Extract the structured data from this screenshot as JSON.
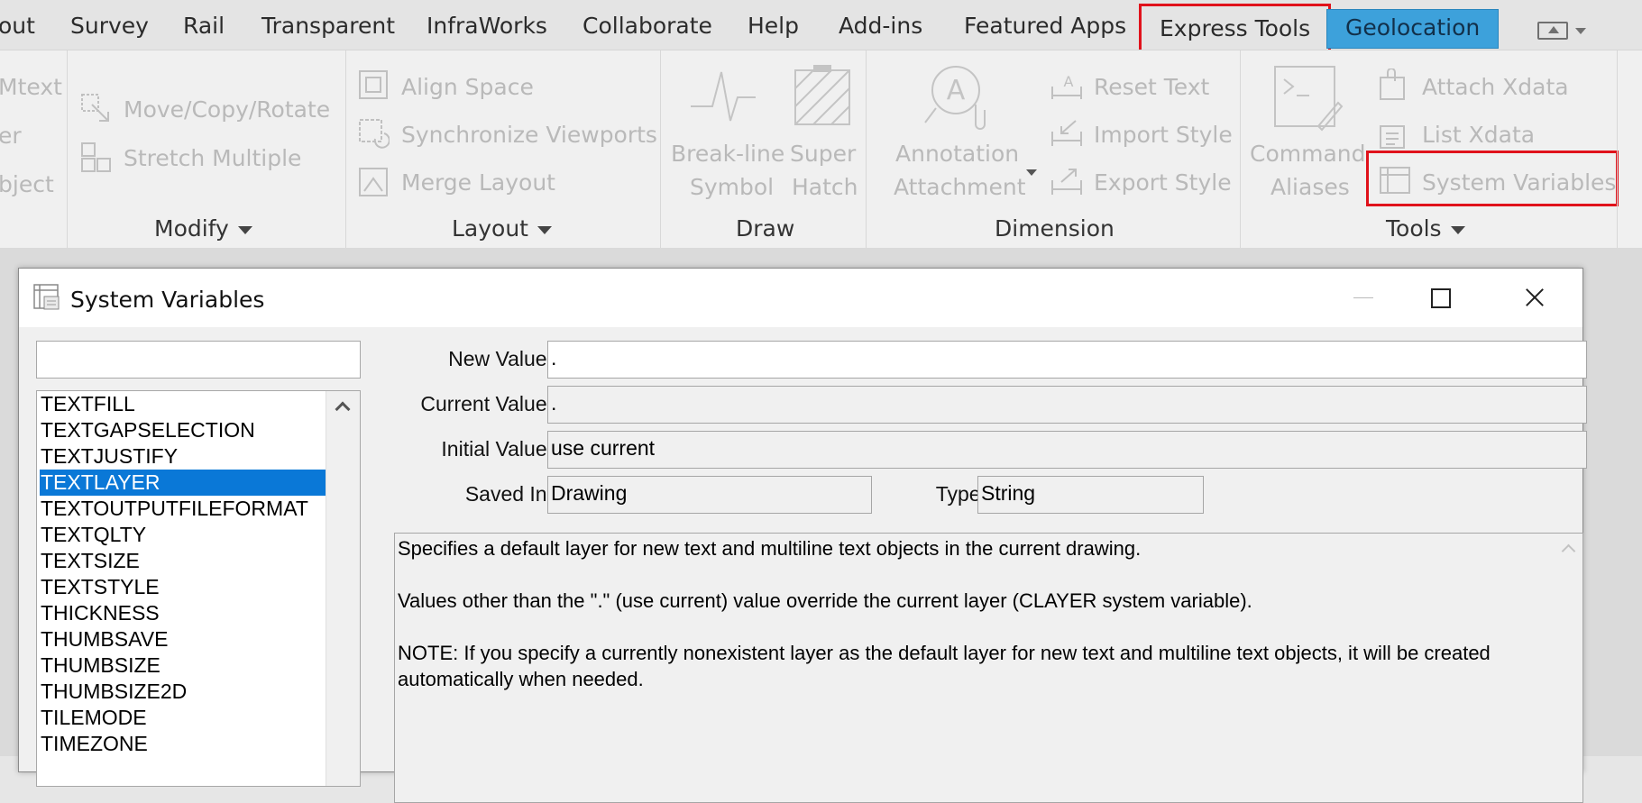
{
  "ribbon_tabs": [
    {
      "label": "out"
    },
    {
      "label": "Survey"
    },
    {
      "label": "Rail"
    },
    {
      "label": "Transparent"
    },
    {
      "label": "InfraWorks"
    },
    {
      "label": "Collaborate"
    },
    {
      "label": "Help"
    },
    {
      "label": "Add-ins"
    },
    {
      "label": "Featured Apps"
    },
    {
      "label": "Express Tools"
    },
    {
      "label": "Geolocation"
    }
  ],
  "ribbon": {
    "cut_labels": [
      "Mtext",
      "er",
      "bject"
    ],
    "modify": {
      "title": "Modify",
      "move_copy_rotate": "Move/Copy/Rotate",
      "stretch_multiple": "Stretch Multiple"
    },
    "layout": {
      "title": "Layout",
      "align_space": "Align Space",
      "synchronize_viewports": "Synchronize Viewports",
      "merge_layout": "Merge Layout"
    },
    "draw": {
      "title": "Draw",
      "break_line_1": "Break-line",
      "break_line_2": "Symbol",
      "super_hatch_1": "Super",
      "super_hatch_2": "Hatch"
    },
    "dimension": {
      "title": "Dimension",
      "annotation_1": "Annotation",
      "annotation_2": "Attachment",
      "reset_text": "Reset Text",
      "import_style": "Import Style",
      "export_style": "Export Style"
    },
    "tools": {
      "title": "Tools",
      "command_1": "Command",
      "command_2": "Aliases",
      "attach_xdata": "Attach Xdata",
      "list_xdata": "List Xdata",
      "system_variables": "System Variables"
    }
  },
  "dialog": {
    "title": "System Variables",
    "search_value": "",
    "variables": [
      "TEXTFILL",
      "TEXTGAPSELECTION",
      "TEXTJUSTIFY",
      "TEXTLAYER",
      "TEXTOUTPUTFILEFORMAT",
      "TEXTQLTY",
      "TEXTSIZE",
      "TEXTSTYLE",
      "THICKNESS",
      "THUMBSAVE",
      "THUMBSIZE",
      "THUMBSIZE2D",
      "TILEMODE",
      "TIMEZONE"
    ],
    "selected_variable": "TEXTLAYER",
    "labels": {
      "new_value": "New Value:",
      "current_value": "Current Value:",
      "initial_value": "Initial Value:",
      "saved_in": "Saved In:",
      "type": "Type:"
    },
    "values": {
      "new_value": ".",
      "current_value": ".",
      "initial_value": "use current",
      "saved_in": "Drawing",
      "type": "String"
    },
    "description": [
      "Specifies a default layer for new text and multiline text objects in the current drawing.",
      "Values other than the \".\" (use current) value override the current layer (CLAYER system variable).",
      "NOTE: If you specify a currently nonexistent layer as the default layer for new text and multiline text objects, it will be created automatically when needed."
    ]
  },
  "colors": {
    "highlight_box": "#e0121b",
    "geolocation_tab": "#3da1db",
    "selection": "#0a78d7"
  }
}
